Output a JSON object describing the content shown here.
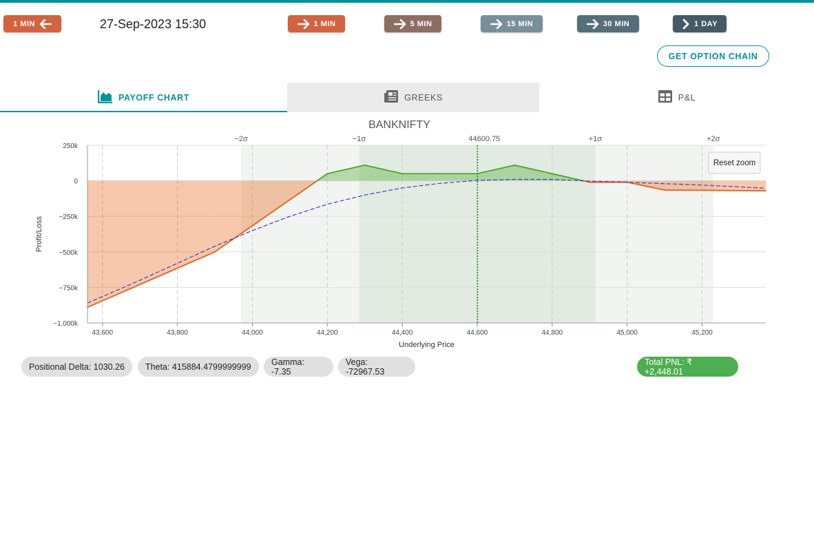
{
  "toolbar": {
    "back_label": "1 MIN",
    "datetime": "27-Sep-2023 15:30",
    "fwd_1min": "1 MIN",
    "fwd_5min": "5 MIN",
    "fwd_15min": "15 MIN",
    "fwd_30min": "30 MIN",
    "fwd_1day": "1 DAY",
    "option_chain": "GET OPTION CHAIN",
    "colors": {
      "back": "#d4623f",
      "m1": "#d4623f",
      "m5": "#8d6e63",
      "m15": "#78909c",
      "m30": "#546e7a",
      "d1": "#455a64"
    }
  },
  "tabs": {
    "payoff": "PAYOFF CHART",
    "greeks": "GREEKS",
    "pl": "P&L",
    "icons": [
      "area-chart-icon",
      "newspaper-icon",
      "table-icon"
    ]
  },
  "chart_data": {
    "type": "line",
    "title": "BANKNIFTY",
    "xlabel": "Underlying Price",
    "ylabel": "Profit/Loss",
    "xlim": [
      43560,
      45370
    ],
    "ylim": [
      -1000000,
      250000
    ],
    "x_ticks": [
      43600,
      43800,
      44000,
      44200,
      44400,
      44600,
      44800,
      45000,
      45200
    ],
    "x_tick_labels": [
      "43,600",
      "43,800",
      "44,000",
      "44,200",
      "44,400",
      "44,600",
      "44,800",
      "45,000",
      "45,200"
    ],
    "y_ticks": [
      250000,
      0,
      -250000,
      -500000,
      -750000,
      -1000000
    ],
    "y_tick_labels": [
      "250k",
      "0",
      "−250k",
      "−500k",
      "−750k",
      "−1,000k"
    ],
    "spot": 44600.75,
    "spot_label": "44600.75",
    "sigma_lines": [
      {
        "label": "−2σ",
        "x": 43970
      },
      {
        "label": "−1σ",
        "x": 44285
      },
      {
        "label": "+1σ",
        "x": 44915
      },
      {
        "label": "+2σ",
        "x": 45230
      }
    ],
    "reset_zoom": "Reset zoom",
    "series": [
      {
        "x": [
          43560,
          43900,
          44200,
          44300,
          44400,
          44500,
          44600,
          44700,
          44800,
          44900,
          45000,
          45100,
          45370
        ],
        "y": [
          -890000,
          -500000,
          50000,
          110000,
          50000,
          50000,
          50000,
          110000,
          50000,
          -10000,
          -10000,
          -65000,
          -70000
        ],
        "color_profit": "#4aa524",
        "color_loss": "#e8600e"
      },
      {
        "x": [
          43560,
          43700,
          43800,
          43900,
          44000,
          44100,
          44200,
          44300,
          44400,
          44500,
          44600,
          44700,
          44800,
          44900,
          45000,
          45100,
          45200,
          45370
        ],
        "y": [
          -860000,
          -700000,
          -580000,
          -460000,
          -350000,
          -250000,
          -165000,
          -100000,
          -50000,
          -18000,
          3000,
          10000,
          10000,
          -2000,
          -10000,
          -20000,
          -30000,
          -52000
        ],
        "color": "#3b3bd6",
        "dashed": true
      }
    ]
  },
  "stats": {
    "delta": "Positional Delta: 1030.26",
    "theta": "Theta: 415884.4799999999",
    "gamma": "Gamma: -7.35",
    "vega": "Vega: -72967.53",
    "pnl": "Total PNL: ₹ +2,448.01"
  }
}
